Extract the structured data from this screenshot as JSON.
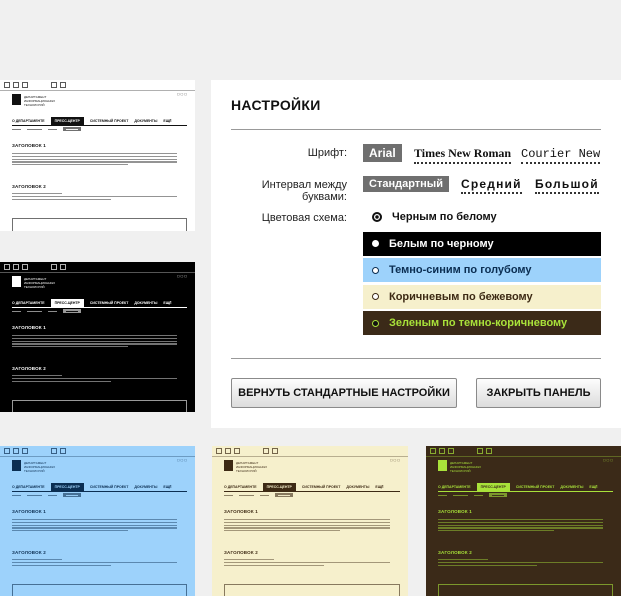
{
  "panel": {
    "title": "НАСТРОЙКИ",
    "font_label": "Шрифт:",
    "fonts": [
      "Arial",
      "Times New Roman",
      "Courier New"
    ],
    "spacing_label": "Интервал между буквами:",
    "spacing": [
      "Стандартный",
      "Средний",
      "Большой"
    ],
    "scheme_label": "Цветовая схема:",
    "schemes": [
      {
        "label": "Черным по белому",
        "bg": "#ffffff",
        "fg": "#111111"
      },
      {
        "label": "Белым по черному",
        "bg": "#000000",
        "fg": "#ffffff"
      },
      {
        "label": "Темно-синим по голубому",
        "bg": "#9dd2fb",
        "fg": "#0b2e52"
      },
      {
        "label": "Коричневым по бежевому",
        "bg": "#f6f0cc",
        "fg": "#3d2a14"
      },
      {
        "label": "Зеленым по темно-коричневому",
        "bg": "#3b2a18",
        "fg": "#a9e23a"
      }
    ],
    "reset_button": "ВЕРНУТЬ СТАНДАРТНЫЕ НАСТРОЙКИ",
    "close_button": "ЗАКРЫТЬ ПАНЕЛЬ"
  },
  "thumbs": {
    "nav_items": [
      "О ДЕПАРТАМЕНТЕ",
      "ПРЕСС-ЦЕНТР",
      "СИСТЕМНЫЙ ПРОЕКТ",
      "ДОКУМЕНТЫ",
      "ЕЩЁ"
    ],
    "heading1": "ЗАГОЛОВОК 1",
    "heading2": "ЗАГОЛОВОК 2",
    "logo_text": "ДЕПАРТАМЕНТ ИНФОРМАЦИОННЫХ ТЕХНОЛОГИЙ"
  }
}
